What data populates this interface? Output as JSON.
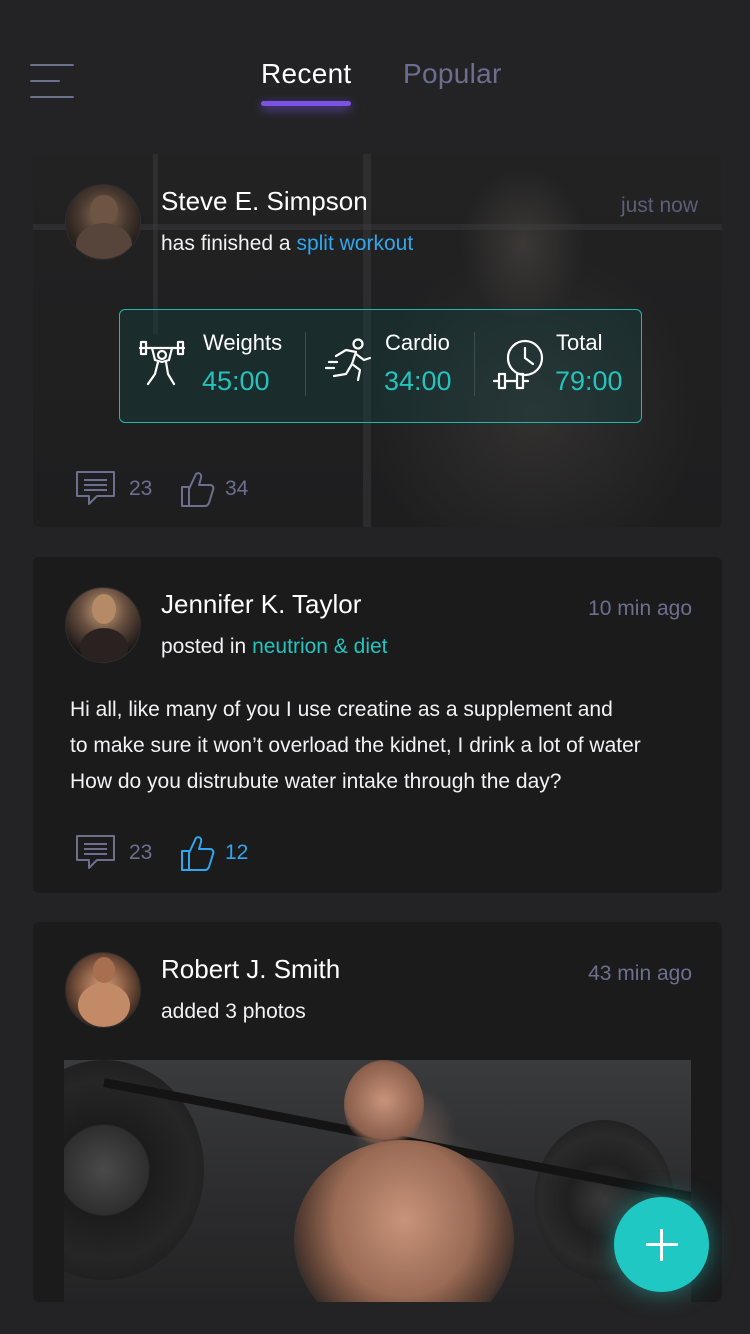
{
  "header": {
    "tabs": [
      {
        "label": "Recent",
        "active": true
      },
      {
        "label": "Popular",
        "active": false
      }
    ]
  },
  "colors": {
    "accent_purple": "#7a52e6",
    "accent_teal": "#22c4bd",
    "link_blue": "#2fa6ee",
    "muted": "#6d6f8e",
    "background": "#232325",
    "card": "#1b1b1c"
  },
  "feed": [
    {
      "author": "Steve E. Simpson",
      "action_prefix": "has finished a",
      "action_link": "split workout",
      "time": "just now",
      "stats": [
        {
          "label": "Weights",
          "value": "45:00",
          "icon": "weightlifter-icon"
        },
        {
          "label": "Cardio",
          "value": "34:00",
          "icon": "runner-icon"
        },
        {
          "label": "Total",
          "value": "79:00",
          "icon": "clock-dumbbell-icon"
        }
      ],
      "comments": "23",
      "likes": "34",
      "liked": false
    },
    {
      "author": "Jennifer K. Taylor",
      "action_prefix": "posted in",
      "action_link": "neutrion & diet",
      "time": "10 min ago",
      "body": [
        "Hi all, like many of you I use creatine as a supplement and",
        "to make sure it won’t overload the kidnet, I drink a lot of water",
        "How do you distrubute water intake through the day?"
      ],
      "comments": "23",
      "likes": "12",
      "liked": true
    },
    {
      "author": "Robert J. Smith",
      "action_prefix": "added 3 photos",
      "time": "43 min ago"
    }
  ],
  "fab": {
    "icon": "plus-icon"
  }
}
